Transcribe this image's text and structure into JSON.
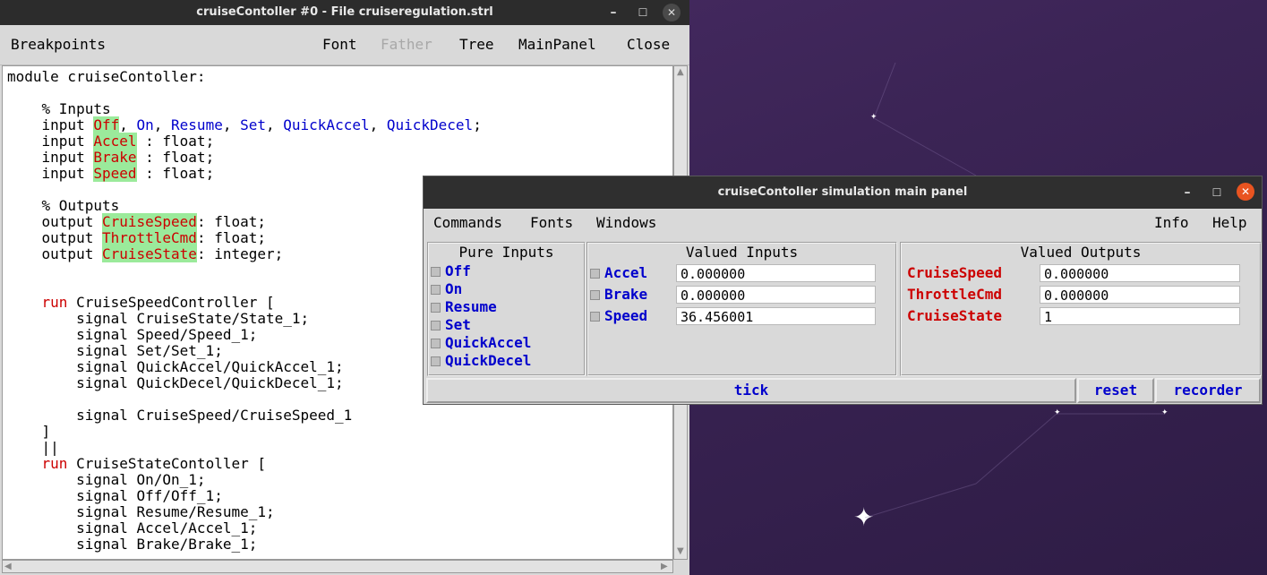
{
  "editor": {
    "title": "cruiseContoller  #0  -  File cruiseregulation.strl",
    "menu": {
      "breakpoints": "Breakpoints",
      "font": "Font",
      "father": "Father",
      "tree": "Tree",
      "mainpanel": "MainPanel",
      "close": "Close"
    },
    "code": [
      [
        [
          "module cruiseContoller:",
          ""
        ]
      ],
      [
        [
          "",
          ""
        ]
      ],
      [
        [
          "    % Inputs",
          ""
        ]
      ],
      [
        [
          "    input ",
          ""
        ],
        [
          "Off",
          "sig"
        ],
        [
          ", ",
          ""
        ],
        [
          "On",
          "blue"
        ],
        [
          ", ",
          ""
        ],
        [
          "Resume",
          "blue"
        ],
        [
          ", ",
          ""
        ],
        [
          "Set",
          "blue"
        ],
        [
          ", ",
          ""
        ],
        [
          "QuickAccel",
          "blue"
        ],
        [
          ", ",
          ""
        ],
        [
          "QuickDecel",
          "blue"
        ],
        [
          ";",
          ""
        ]
      ],
      [
        [
          "    input ",
          ""
        ],
        [
          "Accel",
          "sig"
        ],
        [
          " : float;",
          ""
        ]
      ],
      [
        [
          "    input ",
          ""
        ],
        [
          "Brake",
          "sig"
        ],
        [
          " : float;",
          ""
        ]
      ],
      [
        [
          "    input ",
          ""
        ],
        [
          "Speed",
          "sig"
        ],
        [
          " : float;",
          ""
        ]
      ],
      [
        [
          "",
          ""
        ]
      ],
      [
        [
          "    % Outputs",
          ""
        ]
      ],
      [
        [
          "    output ",
          ""
        ],
        [
          "CruiseSpeed",
          "sig"
        ],
        [
          ": float;",
          ""
        ]
      ],
      [
        [
          "    output ",
          ""
        ],
        [
          "ThrottleCmd",
          "sig"
        ],
        [
          ": float;",
          ""
        ]
      ],
      [
        [
          "    output ",
          ""
        ],
        [
          "CruiseState",
          "sig"
        ],
        [
          ": integer;",
          ""
        ]
      ],
      [
        [
          "",
          ""
        ]
      ],
      [
        [
          "",
          ""
        ]
      ],
      [
        [
          "    ",
          ""
        ],
        [
          "run",
          "kw"
        ],
        [
          " CruiseSpeedController [",
          ""
        ]
      ],
      [
        [
          "        signal CruiseState/State_1;",
          ""
        ]
      ],
      [
        [
          "        signal Speed/Speed_1;",
          ""
        ]
      ],
      [
        [
          "        signal Set/Set_1;",
          ""
        ]
      ],
      [
        [
          "        signal QuickAccel/QuickAccel_1;",
          ""
        ]
      ],
      [
        [
          "        signal QuickDecel/QuickDecel_1;",
          ""
        ]
      ],
      [
        [
          "",
          ""
        ]
      ],
      [
        [
          "        signal CruiseSpeed/CruiseSpeed_1",
          ""
        ]
      ],
      [
        [
          "    ]",
          ""
        ]
      ],
      [
        [
          "    ||",
          ""
        ]
      ],
      [
        [
          "    ",
          ""
        ],
        [
          "run",
          "kw"
        ],
        [
          " CruiseStateContoller [",
          ""
        ]
      ],
      [
        [
          "        signal On/On_1;",
          ""
        ]
      ],
      [
        [
          "        signal Off/Off_1;",
          ""
        ]
      ],
      [
        [
          "        signal Resume/Resume_1;",
          ""
        ]
      ],
      [
        [
          "        signal Accel/Accel_1;",
          ""
        ]
      ],
      [
        [
          "        signal Brake/Brake_1;",
          ""
        ]
      ]
    ]
  },
  "panel": {
    "title": "cruiseContoller simulation main panel",
    "menu": {
      "commands": "Commands",
      "fonts": "Fonts",
      "windows": "Windows",
      "info": "Info",
      "help": "Help"
    },
    "pure_inputs": {
      "title": "Pure Inputs",
      "items": [
        "Off",
        "On",
        "Resume",
        "Set",
        "QuickAccel",
        "QuickDecel"
      ]
    },
    "valued_inputs": {
      "title": "Valued Inputs",
      "items": [
        {
          "name": "Accel",
          "value": "0.000000"
        },
        {
          "name": "Brake",
          "value": "0.000000"
        },
        {
          "name": "Speed",
          "value": "36.456001"
        }
      ]
    },
    "valued_outputs": {
      "title": "Valued Outputs",
      "items": [
        {
          "name": "CruiseSpeed",
          "value": "0.000000"
        },
        {
          "name": "ThrottleCmd",
          "value": "0.000000"
        },
        {
          "name": "CruiseState",
          "value": "1"
        }
      ]
    },
    "buttons": {
      "tick": "tick",
      "reset": "reset",
      "recorder": "recorder"
    }
  },
  "window_controls": {
    "minimize": "–",
    "maximize": "☐",
    "close": "✕"
  },
  "colors": {
    "input_signal_bg": "#9bea9b",
    "signal_red": "#cc0000",
    "signal_blue": "#0000cc",
    "close_orange": "#e95420"
  }
}
